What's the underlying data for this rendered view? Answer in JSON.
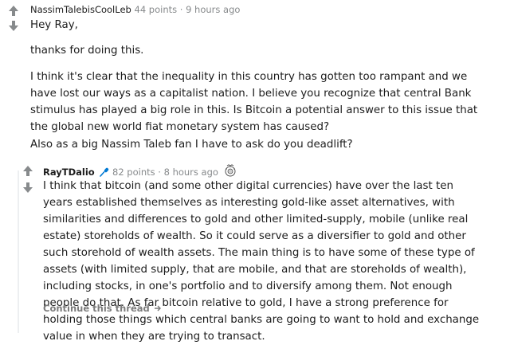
{
  "comment1": {
    "author": "NassimTalebisCoolLeb",
    "points": "44 points",
    "separator": "·",
    "time": "9 hours ago",
    "paragraphs": [
      "Hey Ray,",
      "thanks for doing this.",
      "I think it's clear that the inequality in this country has gotten too rampant and we have lost our ways as a capitalist nation. I believe you recognize that central Bank stimulus has played a big role in this. Is Bitcoin a potential answer to this issue that the global new world fiat monetary system has caused?",
      "Also as a big Nassim Taleb fan I have to ask do you deadlift?"
    ]
  },
  "comment2": {
    "author": "RayTDalio",
    "points": "82 points",
    "separator": "·",
    "time": "8 hours ago",
    "body": "I think that bitcoin (and some other digital currencies) have over the last ten years established themselves as interesting gold-like asset alternatives, with similarities and differences to gold and other limited-supply, mobile (unlike real estate) storeholds of wealth. So it could serve as a diversifier to gold and other such storehold of wealth assets. The main thing is to have some of these type of assets (with limited supply, that are mobile, and that are storeholds of wealth), including stocks, in one's portfolio and to diversify among them. Not enough people do that. As far bitcoin relative to gold, I have a strong preference for holding those things which central banks are going to want to hold and exchange value in when they are trying to transact."
  },
  "continue_thread": "Continue this thread",
  "colors": {
    "vote_arrow": "#878a8c",
    "flair_blue": "#0079d3",
    "meta_gray": "#878a8c"
  },
  "icons": {
    "upvote": "arrow-up-icon",
    "downvote": "arrow-down-icon",
    "flair": "microphone-icon",
    "award": "award-icon",
    "continue": "arrow-right-icon"
  }
}
